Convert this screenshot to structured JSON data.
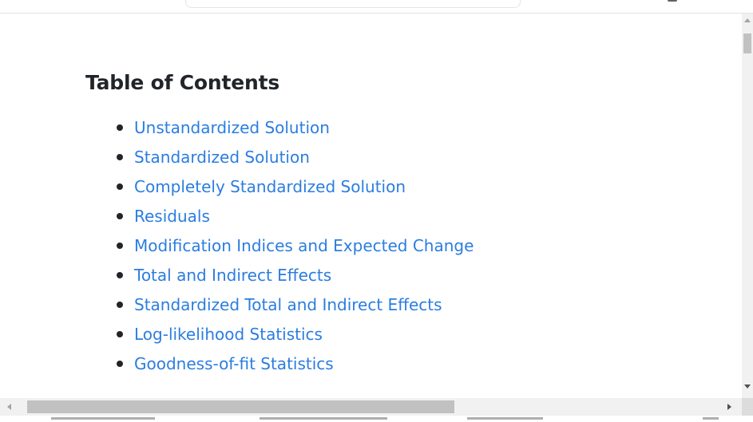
{
  "toc": {
    "heading": "Table of Contents",
    "items": [
      {
        "label": "Unstandardized Solution"
      },
      {
        "label": "Standardized Solution"
      },
      {
        "label": "Completely Standardized Solution"
      },
      {
        "label": "Residuals"
      },
      {
        "label": "Modification Indices and Expected Change"
      },
      {
        "label": "Total and Indirect Effects"
      },
      {
        "label": "Standardized Total and Indirect Effects"
      },
      {
        "label": "Log-likelihood Statistics"
      },
      {
        "label": "Goodness-of-fit Statistics"
      }
    ]
  },
  "colors": {
    "link": "#2b7de0",
    "text": "#212529",
    "scrollbar_track": "#f1f1f1",
    "scrollbar_thumb": "#c1c1c1"
  },
  "scroll": {
    "vertical_position_fraction": 0.0,
    "horizontal_visible_fraction": 0.6
  }
}
